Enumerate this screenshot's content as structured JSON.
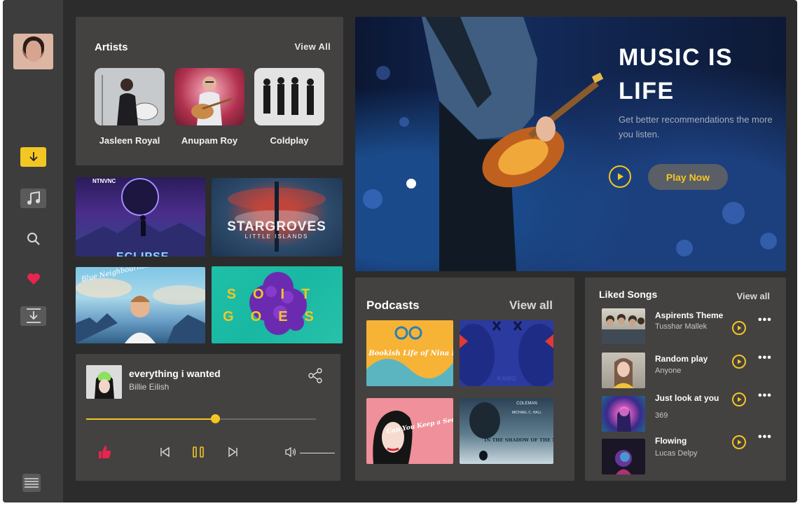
{
  "sidebar": {
    "avatar": "user-avatar",
    "items": [
      {
        "icon": "download-icon",
        "active": true
      },
      {
        "icon": "music-note-icon"
      },
      {
        "icon": "search-icon"
      },
      {
        "icon": "heart-icon"
      },
      {
        "icon": "download-tray-icon"
      }
    ],
    "menu_icon": "hamburger-icon"
  },
  "artists": {
    "title": "Artists",
    "view_all": "View  All",
    "items": [
      {
        "name": "Jasleen Royal"
      },
      {
        "name": "Anupam Roy"
      },
      {
        "name": "Coldplay"
      }
    ]
  },
  "albums": [
    {
      "label_top": "NTNVNC",
      "label_bottom": "ECLIPSE"
    },
    {
      "title": "STARGROVES",
      "subtitle": "LITTLE ISLANDS"
    },
    {
      "title": "Blue Neighbourhood"
    },
    {
      "title_line1": "SOIT",
      "title_line2": "GOES"
    }
  ],
  "player": {
    "song": "everything i wanted",
    "artist": "Billie Eilish",
    "progress": 0.56,
    "icons": {
      "share": "share-icon",
      "like": "thumbs-up-icon",
      "prev": "skip-previous-icon",
      "pause": "pause-icon",
      "next": "skip-next-icon",
      "volume": "volume-icon"
    }
  },
  "hero": {
    "title": "MUSIC IS LIFE",
    "subtitle": "Get better recommendations the more you listen.",
    "play_now": "Play Now"
  },
  "podcasts": {
    "title": "Podcasts",
    "view_all": "View all",
    "items": [
      {
        "text": "the Bookish Life of Nina Hill"
      },
      {
        "text": "KAWS"
      },
      {
        "text": "Can You Keep a Secret?"
      },
      {
        "text_top": "COLEMAN",
        "text_mid": "MICHAEL C. HALL",
        "text_main": "IN THE SHADOW OF THE MOON"
      }
    ]
  },
  "liked": {
    "title": "Liked Songs",
    "view_all": "View all",
    "items": [
      {
        "name": "Aspirents Theme",
        "sub": "Tusshar Mallek"
      },
      {
        "name": "Random play",
        "sub": "Anyone"
      },
      {
        "name": "Just look at you",
        "sub": "369"
      },
      {
        "name": "Flowing",
        "sub": "Lucas Delpy"
      }
    ],
    "more_label": "•••"
  },
  "colors": {
    "accent": "#f3c623",
    "heart": "#e8244f",
    "panel": "#444141",
    "background": "#2c2c2c"
  }
}
